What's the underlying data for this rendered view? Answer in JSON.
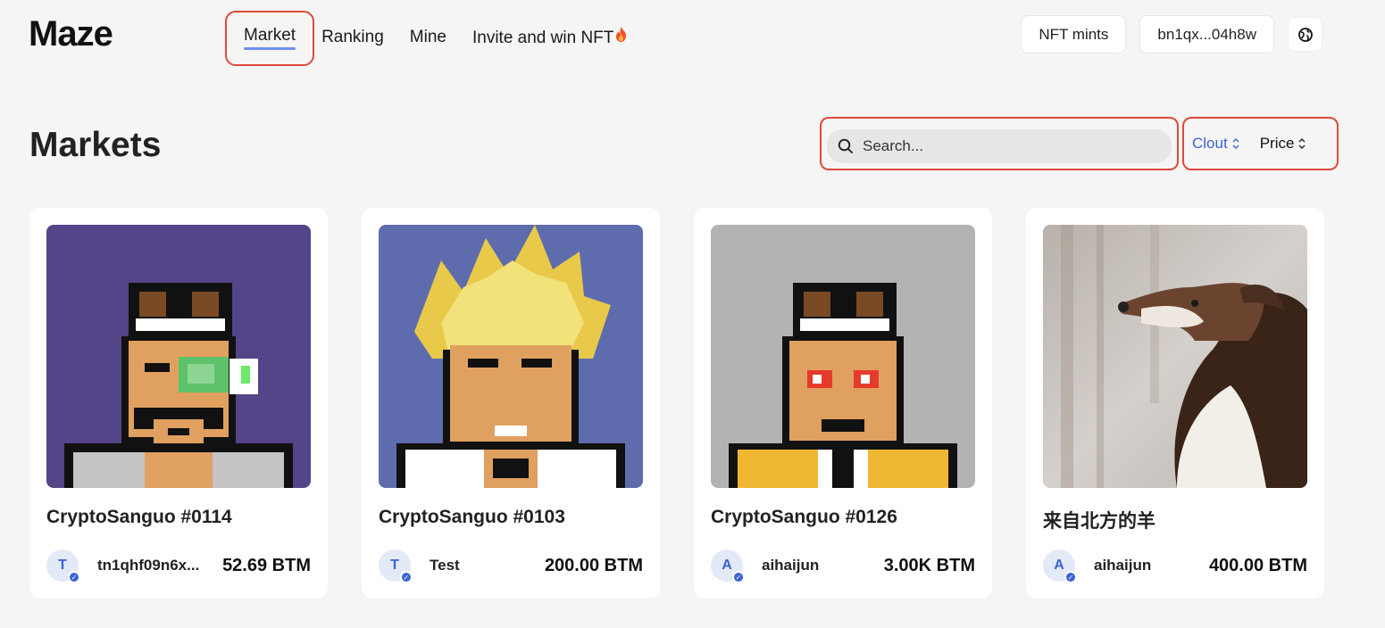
{
  "header": {
    "logo": "Maze",
    "nav": [
      {
        "label": "Market",
        "active": true
      },
      {
        "label": "Ranking",
        "active": false
      },
      {
        "label": "Mine",
        "active": false
      },
      {
        "label": "Invite and win NFT",
        "active": false
      }
    ],
    "nft_mints_label": "NFT mints",
    "wallet_address": "bn1qx...04h8w",
    "globe_icon": "globe-icon"
  },
  "page": {
    "title": "Markets"
  },
  "search": {
    "placeholder": "Search..."
  },
  "sort": {
    "options": [
      {
        "label": "Clout",
        "active": true
      },
      {
        "label": "Price",
        "active": false
      }
    ]
  },
  "cards": [
    {
      "title": "CryptoSanguo #0114",
      "avatar_letter": "T",
      "owner": "tn1qhf09n6x...",
      "price": "52.69 BTM",
      "bg": "#544488"
    },
    {
      "title": "CryptoSanguo #0103",
      "avatar_letter": "T",
      "owner": "Test",
      "price": "200.00 BTM",
      "bg": "#5e6cae"
    },
    {
      "title": "CryptoSanguo #0126",
      "avatar_letter": "A",
      "owner": "aihaijun",
      "price": "3.00K BTM",
      "bg": "#b3b3b3"
    },
    {
      "title": "来自北方的羊",
      "avatar_letter": "A",
      "owner": "aihaijun",
      "price": "400.00 BTM",
      "bg": "#c9c4c0"
    }
  ],
  "colors": {
    "accent": "#3b63d6",
    "highlight_border": "#e04a3a",
    "nav_underline": "#6e8ef0"
  }
}
